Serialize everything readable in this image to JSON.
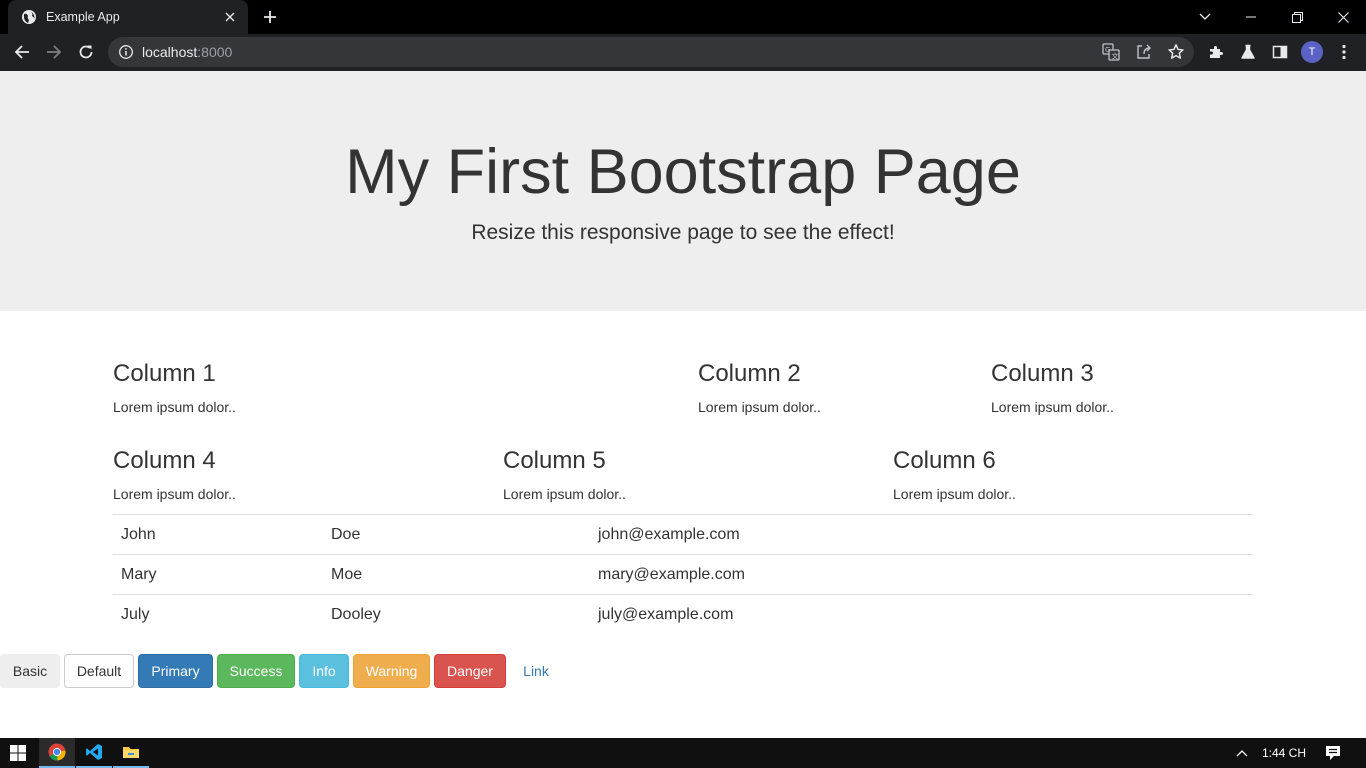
{
  "browser": {
    "tab_title": "Example App",
    "url_host": "localhost",
    "url_port": ":8000",
    "profile_initial": "T"
  },
  "jumbotron": {
    "title": "My First Bootstrap Page",
    "subtitle": "Resize this responsive page to see the effect!"
  },
  "columns": [
    {
      "heading": "Column 1",
      "text": "Lorem ipsum dolor.."
    },
    {
      "heading": "Column 2",
      "text": "Lorem ipsum dolor.."
    },
    {
      "heading": "Column 3",
      "text": "Lorem ipsum dolor.."
    },
    {
      "heading": "Column 4",
      "text": "Lorem ipsum dolor.."
    },
    {
      "heading": "Column 5",
      "text": "Lorem ipsum dolor.."
    },
    {
      "heading": "Column 6",
      "text": "Lorem ipsum dolor.."
    }
  ],
  "table": {
    "rows": [
      [
        "John",
        "Doe",
        "john@example.com"
      ],
      [
        "Mary",
        "Moe",
        "mary@example.com"
      ],
      [
        "July",
        "Dooley",
        "july@example.com"
      ]
    ]
  },
  "buttons": {
    "basic": "Basic",
    "default": "Default",
    "primary": "Primary",
    "success": "Success",
    "info": "Info",
    "warning": "Warning",
    "danger": "Danger",
    "link": "Link"
  },
  "colors": {
    "primary": "#337ab7",
    "success": "#5cb85c",
    "info": "#5bc0de",
    "warning": "#f0ad4e",
    "danger": "#d9534f",
    "link": "#337ab7",
    "jumbotron_bg": "#eeeeee"
  },
  "taskbar": {
    "clock": "1:44 CH",
    "apps": [
      "chrome-icon",
      "vscode-icon",
      "file-explorer-icon"
    ]
  }
}
